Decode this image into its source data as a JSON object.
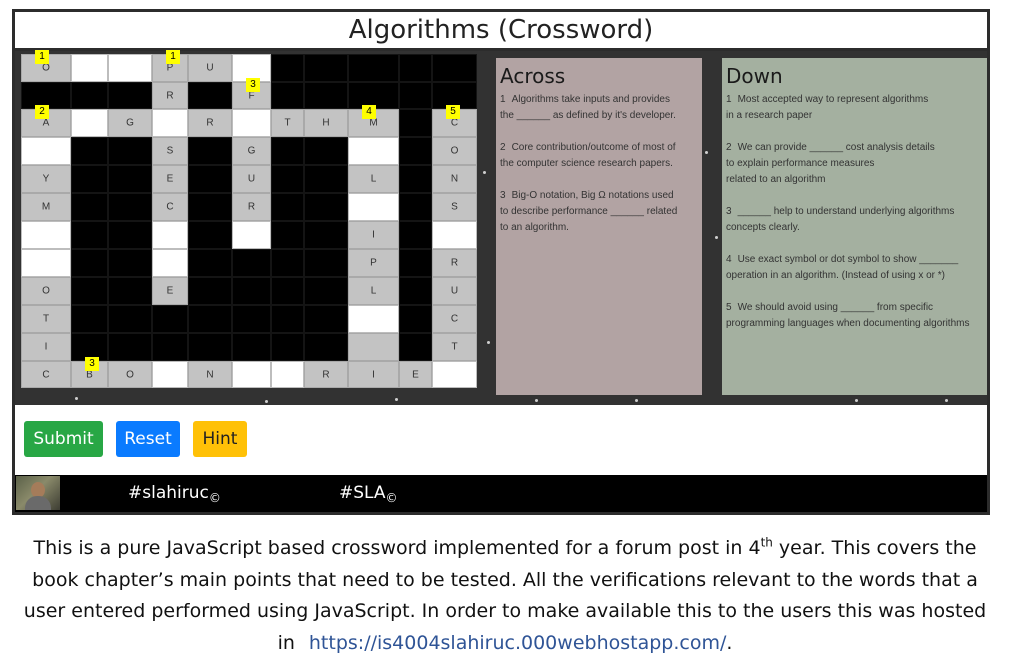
{
  "header": {
    "title": "Algorithms (Crossword)"
  },
  "grid": {
    "rows": 12,
    "cols": 11,
    "cells": [
      [
        "g:O:1",
        "w",
        "w",
        "g:P:1",
        "g:U",
        "w",
        "b",
        "b",
        "b",
        "b",
        "b"
      ],
      [
        "b",
        "b",
        "b",
        "g:R",
        "b",
        "g:F:3",
        "b",
        "b",
        "b",
        "b",
        "b"
      ],
      [
        "g:A:2",
        "w",
        "g:G",
        "w",
        "g:R",
        "w",
        "g:T",
        "g:H",
        "g:M:4",
        "b",
        "g:C:5"
      ],
      [
        "w",
        "b",
        "b",
        "g:S",
        "b",
        "g:G",
        "b",
        "b",
        "w",
        "b",
        "g:O"
      ],
      [
        "g:Y",
        "b",
        "b",
        "g:E",
        "b",
        "g:U",
        "b",
        "b",
        "g:L",
        "b",
        "g:N"
      ],
      [
        "g:M",
        "b",
        "b",
        "g:C",
        "b",
        "g:R",
        "b",
        "b",
        "w",
        "b",
        "g:S"
      ],
      [
        "w",
        "b",
        "b",
        "w",
        "b",
        "w",
        "b",
        "b",
        "g:I",
        "b",
        "w"
      ],
      [
        "w",
        "b",
        "b",
        "w",
        "b",
        "b",
        "b",
        "b",
        "g:P",
        "b",
        "g:R"
      ],
      [
        "g:O",
        "b",
        "b",
        "g:E",
        "b",
        "b",
        "b",
        "b",
        "g:L",
        "b",
        "g:U"
      ],
      [
        "g:T",
        "b",
        "b",
        "b",
        "b",
        "b",
        "b",
        "b",
        "w",
        "b",
        "g:C"
      ],
      [
        "g:I",
        "b",
        "b",
        "b",
        "b",
        "b",
        "b",
        "b",
        "g:",
        "b",
        "g:T"
      ],
      [
        "g:C",
        "g:B:3",
        "g:O",
        "w",
        "g:N",
        "w",
        "w",
        "g:R",
        "g:I",
        "g:E",
        "w"
      ]
    ]
  },
  "across": {
    "heading": "Across",
    "clues": [
      {
        "num": "1",
        "lines": [
          "Algorithms take inputs and provides",
          "the ______ as defined by it's developer."
        ]
      },
      {
        "num": "2",
        "lines": [
          "Core contribution/outcome of most of",
          "the computer science research papers."
        ]
      },
      {
        "num": "3",
        "lines": [
          "Big-O notation, Big Ω notations used",
          "to describe performance ______ related",
          "to an algorithm."
        ]
      }
    ]
  },
  "down": {
    "heading": "Down",
    "clues": [
      {
        "num": "1",
        "lines": [
          "Most accepted way to represent algorithms",
          "in a research paper"
        ]
      },
      {
        "num": "2",
        "lines": [
          "We can provide ______ cost analysis details",
          "to explain performance measures",
          "related to an algorithm"
        ]
      },
      {
        "num": "3",
        "lines": [
          "______ help to understand underlying algorithms",
          "concepts clearly."
        ]
      },
      {
        "num": "4",
        "lines": [
          "Use exact symbol or dot symbol to show _______",
          "operation in an algorithm. (Instead of using x or *)"
        ]
      },
      {
        "num": "5",
        "lines": [
          "We should avoid using ______ from specific",
          "programming languages when documenting algorithms"
        ]
      }
    ]
  },
  "buttons": {
    "submit": "Submit",
    "reset": "Reset",
    "hint": "Hint"
  },
  "footer": {
    "tag1": "#slahiruc",
    "tag2": "#SLA",
    "copyright": "©"
  },
  "caption": {
    "line1_pre": "This is a pure JavaScript based crossword implemented for a forum post in 4",
    "line1_sup": "th",
    "line1_post": " year. This covers the",
    "line2": "book chapter’s main points that need to be tested. All the verifications relevant to the words that a",
    "line3": "user entered performed using JavaScript. In order to make available this to the users this was hosted",
    "line4_pre": "in",
    "link": "https://is4004slahiruc.000webhostapp.com/",
    "line4_post": "."
  },
  "colors": {
    "background": "#2c2c2c",
    "across_panel": "#b2a3a3",
    "down_panel": "#a4b0a0",
    "number_badge": "#ffff00",
    "submit": "#28a745",
    "reset": "#0a7bff",
    "hint": "#ffc107",
    "link": "#2f5496"
  }
}
